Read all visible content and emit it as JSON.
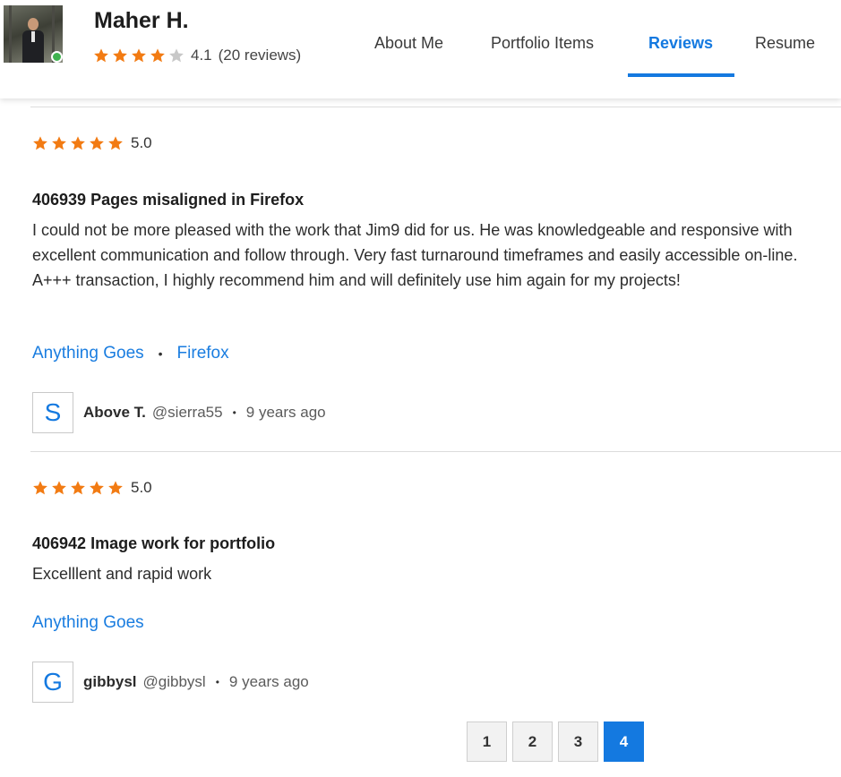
{
  "profile": {
    "name": "Maher H.",
    "rating": 4.1,
    "rating_text": "4.1",
    "reviews_count_text": "(20 reviews)",
    "online": true
  },
  "tabs": [
    {
      "label": "About Me",
      "active": false
    },
    {
      "label": "Portfolio Items",
      "active": false
    },
    {
      "label": "Reviews",
      "active": true
    },
    {
      "label": "Resume",
      "active": false
    }
  ],
  "reviews": [
    {
      "rating": 5,
      "rating_text": "5.0",
      "title": "406939 Pages misaligned in Firefox",
      "body": "I could not be more pleased with the work that Jim9 did for us. He was knowledgeable and responsive with excellent communication and follow through. Very fast turnaround timeframes and easily accessible on-line. A+++ transaction, I highly recommend him and will definitely use him again for my projects!",
      "tags": [
        "Anything Goes",
        "Firefox"
      ],
      "reviewer": {
        "initial": "S",
        "name": "Above T.",
        "handle": "@sierra55",
        "time": "9 years ago"
      }
    },
    {
      "rating": 5,
      "rating_text": "5.0",
      "title": "406942 Image work for portfolio",
      "body": "Excelllent and rapid work",
      "tags": [
        "Anything Goes"
      ],
      "reviewer": {
        "initial": "G",
        "name": "gibbysl",
        "handle": "@gibbysl",
        "time": "9 years ago"
      }
    }
  ],
  "pagination": {
    "pages": [
      "1",
      "2",
      "3",
      "4"
    ],
    "current": "4"
  },
  "colors": {
    "accent": "#1479e0",
    "star_filled": "#f27b13",
    "star_empty": "#c8c8c8",
    "online": "#3fb34f"
  },
  "icons": {
    "star": "star-icon",
    "online": "online-status-icon"
  }
}
